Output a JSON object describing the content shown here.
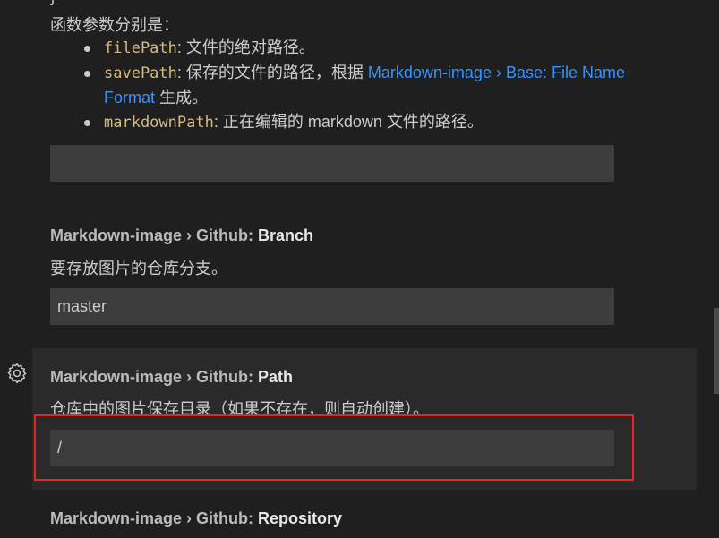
{
  "intro": {
    "brace": "}",
    "params_heading": "函数参数分别是：",
    "params": [
      {
        "name": "filePath",
        "sep": ": ",
        "desc": "文件的绝对路径。",
        "link": "",
        "desc_after": ""
      },
      {
        "name": "savePath",
        "sep": ": ",
        "desc": "保存的文件的路径，根据 ",
        "link": "Markdown-image › Base: File Name Format",
        "desc_after": " 生成。"
      },
      {
        "name": "markdownPath",
        "sep": ": ",
        "desc": "正在编辑的 markdown 文件的路径。",
        "link": "",
        "desc_after": ""
      }
    ],
    "input_value": ""
  },
  "settings": [
    {
      "category": "Markdown-image › Github: ",
      "key": "Branch",
      "description": "要存放图片的仓库分支。",
      "value": "master"
    },
    {
      "category": "Markdown-image › Github: ",
      "key": "Path",
      "description": "仓库中的图片保存目录（如果不存在，则自动创建）。",
      "value": "/"
    },
    {
      "category": "Markdown-image › Github: ",
      "key": "Repository",
      "description": "",
      "value": ""
    }
  ],
  "icons": {
    "gear": "gear-icon"
  },
  "colors": {
    "background": "#1f1f1f",
    "input_background": "#3c3c3c",
    "link": "#3794ff",
    "code": "#d7ba7d",
    "highlight_border": "#e5242b"
  }
}
